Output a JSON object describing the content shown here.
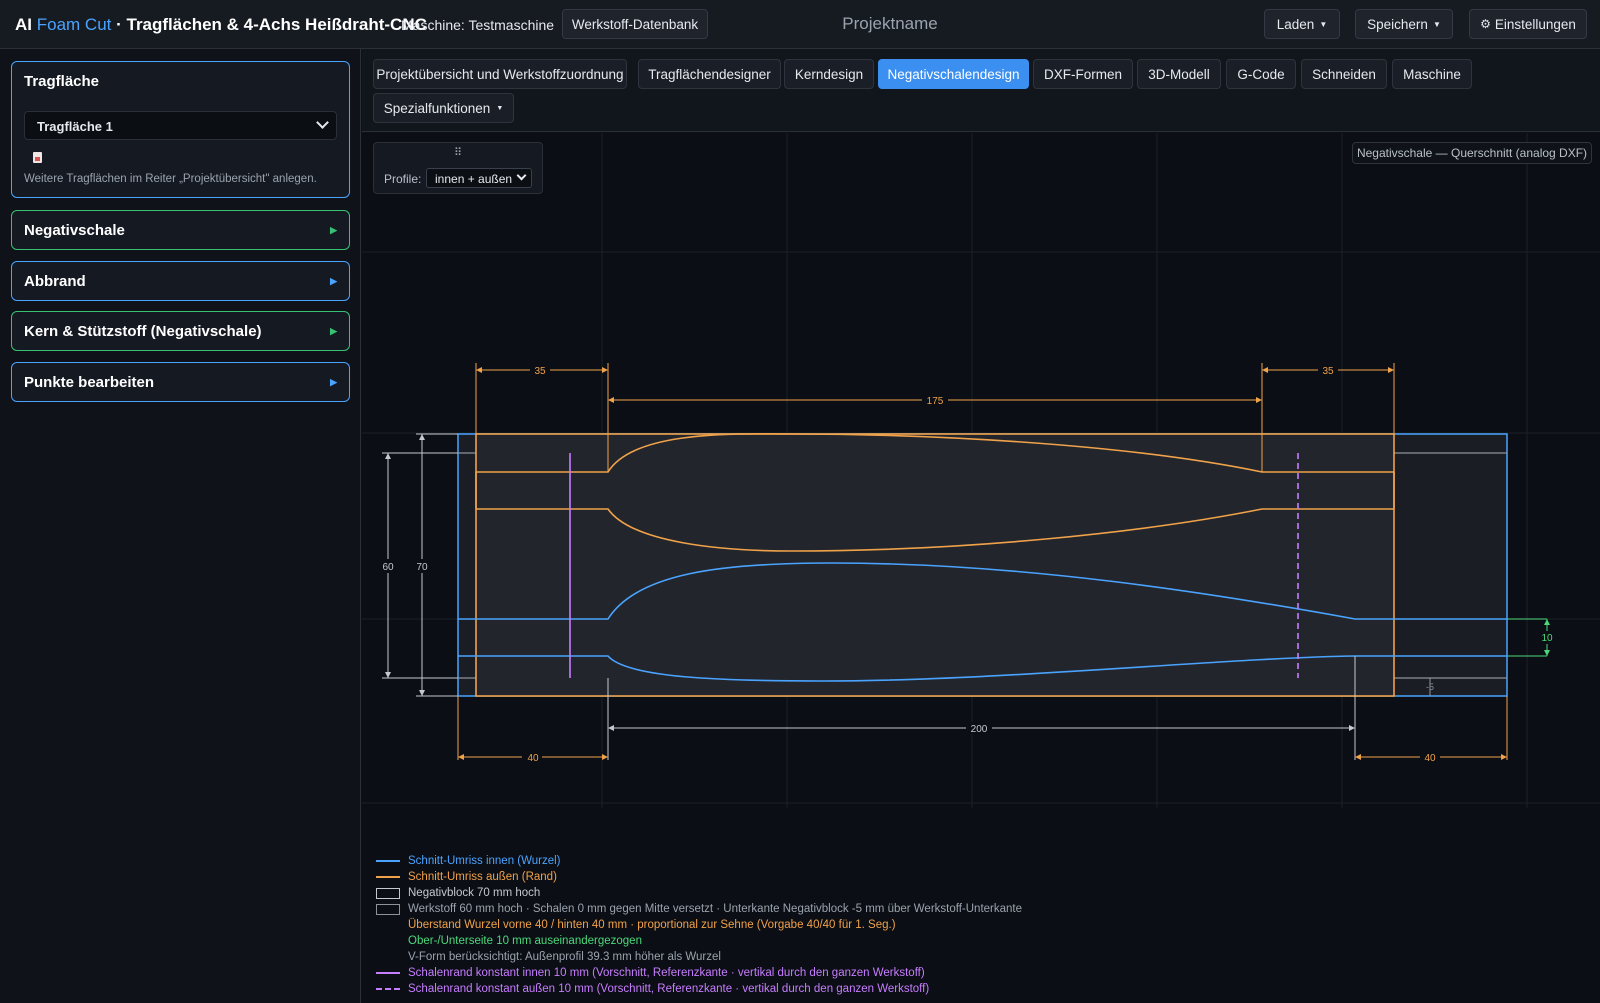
{
  "header": {
    "brand_ai": "AI",
    "brand_foamcut": "Foam Cut",
    "brand_rest": "· Tragflächen & 4-Achs Heißdraht-CNC",
    "machine": "Maschine: Testmaschine",
    "material_db": "Werkstoff-Datenbank",
    "project_name": "Projektname",
    "load": "Laden",
    "save": "Speichern",
    "settings": "Einstellungen"
  },
  "sidebar": {
    "wing_panel": {
      "title": "Tragfläche",
      "selected": "Tragfläche 1",
      "hint": "Weitere Tragflächen im Reiter „Projektübersicht\" anlegen."
    },
    "panels": [
      {
        "title": "Negativschale",
        "color": "#38c172"
      },
      {
        "title": "Abbrand",
        "color": "#4aa3ff"
      },
      {
        "title": "Kern & Stützstoff (Negativschale)",
        "color": "#38c172"
      },
      {
        "title": "Punkte bearbeiten",
        "color": "#4aa3ff"
      }
    ]
  },
  "tabs": [
    {
      "label": "Projektübersicht und Werkstoffzuordnung",
      "active": false
    },
    {
      "label": "Tragflächendesigner",
      "active": false
    },
    {
      "label": "Kerndesign",
      "active": false
    },
    {
      "label": "Negativschalendesign",
      "active": true
    },
    {
      "label": "DXF-Formen",
      "active": false
    },
    {
      "label": "3D-Modell",
      "active": false
    },
    {
      "label": "G-Code",
      "active": false
    },
    {
      "label": "Schneiden",
      "active": false
    },
    {
      "label": "Maschine",
      "active": false
    },
    {
      "label": "Spezialfunktionen",
      "active": false
    }
  ],
  "canvas": {
    "profile_label": "Profile:",
    "profile_value": "innen + außen",
    "caption": "Negativschale — Querschnitt (analog DXF)",
    "dims": {
      "top_left": "35",
      "top_mid": "175",
      "top_right": "35",
      "height_material": "60",
      "height_block": "70",
      "spread": "10",
      "offset": "-5",
      "bottom_mid": "200",
      "bottom_left": "40",
      "bottom_right": "40"
    },
    "colors": {
      "inner": "#4aa3ff",
      "outer": "#f0a24a",
      "block": "#c4c9d0",
      "green": "#4cd97b",
      "purple": "#c77dff"
    }
  },
  "legend": [
    {
      "text": "Schnitt-Umriss innen (Wurzel)",
      "color": "#4aa3ff",
      "swatch": "line"
    },
    {
      "text": "Schnitt-Umriss außen (Rand)",
      "color": "#f0a24a",
      "swatch": "line"
    },
    {
      "text": "Negativblock 70 mm hoch",
      "color": "#c4c9d0",
      "swatch": "box"
    },
    {
      "text": "Werkstoff 60 mm hoch · Schalen 0 mm gegen Mitte versetzt · Unterkante Negativblock -5 mm über Werkstoff-Unterkante",
      "color": "#9aa3ae",
      "swatch": "box"
    },
    {
      "text": "Überstand Wurzel vorne 40 / hinten 40 mm · proportional zur Sehne (Vorgabe 40/40 für 1. Seg.)",
      "color": "#f0a24a",
      "swatch": "none"
    },
    {
      "text": "Ober-/Unterseite 10 mm auseinandergezogen",
      "color": "#4cd97b",
      "swatch": "none"
    },
    {
      "text": "V-Form berücksichtigt: Außenprofil 39.3 mm höher als Wurzel",
      "color": "#9aa3ae",
      "swatch": "none"
    },
    {
      "text": "Schalenrand konstant innen 10 mm (Vorschnitt, Referenzkante · vertikal durch den ganzen Werkstoff)",
      "color": "#c77dff",
      "swatch": "line"
    },
    {
      "text": "Schalenrand konstant außen 10 mm (Vorschnitt, Referenzkante · vertikal durch den ganzen Werkstoff)",
      "color": "#c77dff",
      "swatch": "dash"
    }
  ]
}
